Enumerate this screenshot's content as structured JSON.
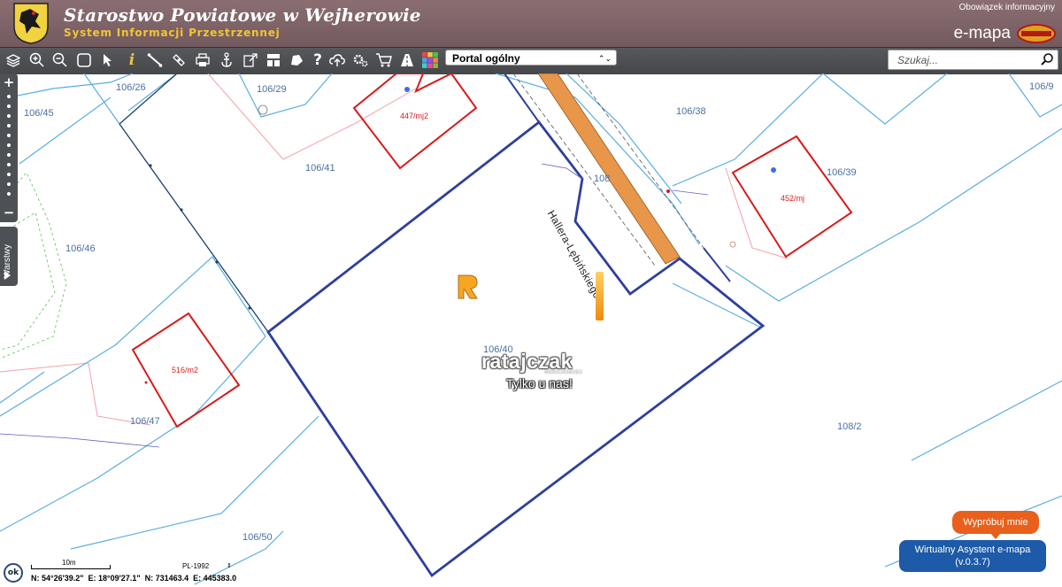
{
  "header": {
    "title": "Starostwo Powiatowe w Wejherowie",
    "subtitle": "System Informacji Przestrzennej",
    "info_link": "Obowiązek informacyjny",
    "emapa_logo": "e-mapa",
    "geosystem_badge": "GEO-SYSTEM"
  },
  "toolbar": {
    "icons": [
      "layers-icon",
      "zoom-in-icon",
      "zoom-out-icon",
      "full-extent-icon",
      "pointer-icon",
      "info-icon",
      "measure-icon",
      "link-icon",
      "print-icon",
      "anchor-icon",
      "export-icon",
      "layout-icon",
      "draw-icon",
      "help-icon",
      "upload-icon",
      "settings-icon",
      "cart-icon",
      "road-icon",
      "color-tiles-icon"
    ],
    "portal_select": "Portal ogólny",
    "search_placeholder": "Szukaj..."
  },
  "map": {
    "parcels": [
      "106/26",
      "106/29",
      "106/45",
      "106/46",
      "106/47",
      "106/50",
      "106/41",
      "106/40",
      "106/38",
      "106/39",
      "106/9",
      "108/2",
      "108"
    ],
    "buildings": [
      "447/mj2",
      "452/mj",
      "516/m2"
    ],
    "street": "Hallera-Lębińskiego",
    "colors": {
      "parcel_line": "#5aaee0",
      "selected_parcel": "#2e3f9e",
      "building": "#d81a1a",
      "street": "#e8964a"
    }
  },
  "side_controls": {
    "zoom_in": "+",
    "zoom_out": "−",
    "layers_tab": "Warstwy"
  },
  "watermark": {
    "name": "ratajczak",
    "sub": "NIERUCHOMOŚCI",
    "tagline": "Tylko u nas!"
  },
  "footer": {
    "ok": "ok",
    "scale": "10m",
    "crs": "PL-1992",
    "coords": "N: 54°26'39.2\"  E: 18°09'27.1\"  N: 731463.4  E: 445383.0"
  },
  "assistant": {
    "try_label": "Wypróbuj mnie",
    "name": "Wirtualny Asystent e-mapa",
    "version": "(v.0.3.7)"
  }
}
